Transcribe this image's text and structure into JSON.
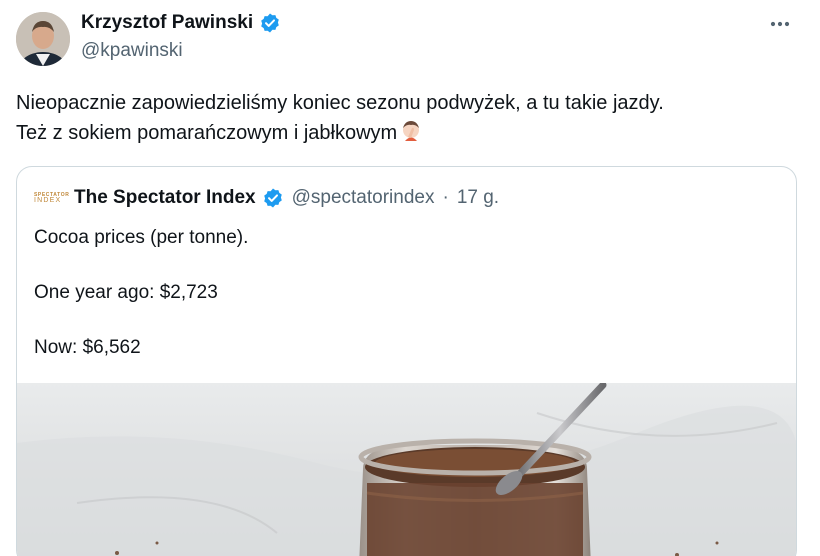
{
  "author": {
    "name": "Krzysztof Pawinski",
    "handle": "@kpawinski"
  },
  "tweet": {
    "line1": "Nieopacznie zapowiedzieliśmy koniec sezonu podwyżek, a tu takie jazdy.",
    "line2": "Też z sokiem pomarańczowym i jabłkowym"
  },
  "quoted": {
    "logo_line1": "SPECTATOR",
    "logo_line2": "INDEX",
    "name": "The Spectator Index",
    "handle": "@spectatorindex",
    "separator": "·",
    "time": "17 g.",
    "lines": [
      "Cocoa prices (per tonne).",
      "One year ago: $2,723",
      "Now: $6,562"
    ]
  },
  "icons": {
    "verified": "verified-badge-icon",
    "more": "more-options-icon",
    "emoji": "facepalm-emoji-icon"
  },
  "colors": {
    "verified_blue": "#1d9bf0",
    "text_primary": "#0f1419",
    "text_secondary": "#536471",
    "border": "#cfd9de"
  }
}
